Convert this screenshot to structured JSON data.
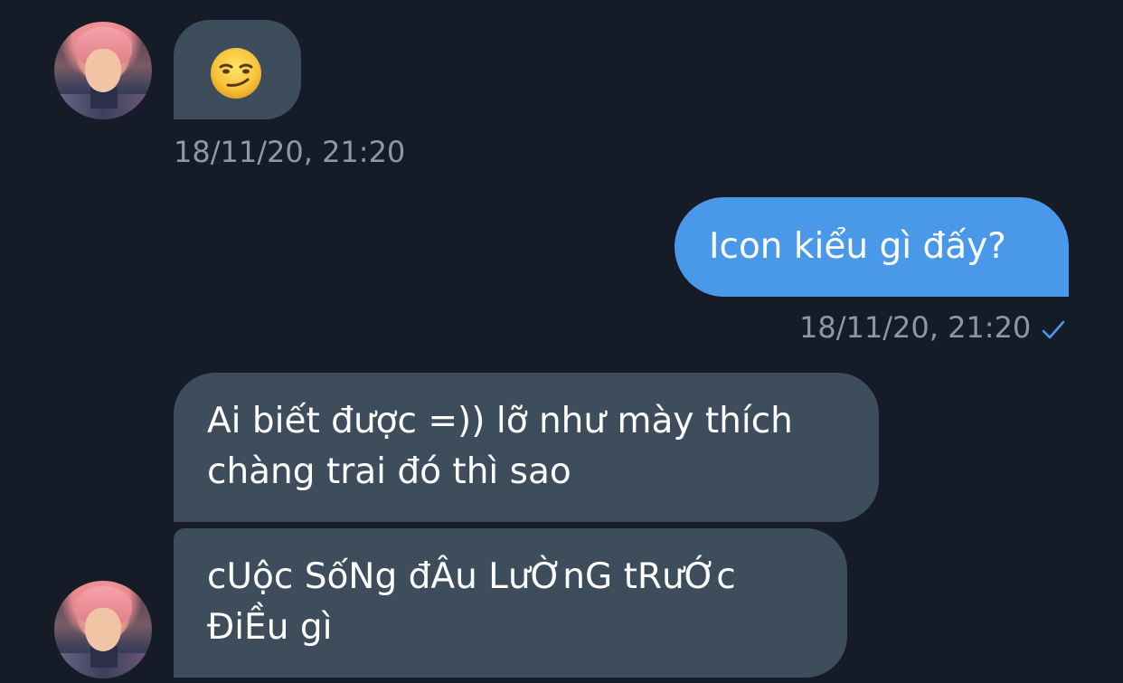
{
  "messages": [
    {
      "sender": "contact",
      "text": "",
      "emoji": "smirking-face",
      "timestamp": "18/11/20, 21:20"
    },
    {
      "sender": "me",
      "text": "Icon kiểu gì đấy?",
      "timestamp": "18/11/20, 21:20",
      "status": "sent"
    },
    {
      "sender": "contact",
      "text_lines": [
        "Ai biết được =)) lỡ như mày thích",
        "chàng trai đó thì sao"
      ]
    },
    {
      "sender": "contact",
      "text_lines": [
        "cUộc SốNg đÂu LưỜnG tRưỚc",
        "ĐiỀu gì"
      ]
    }
  ],
  "colors": {
    "background": "#151c27",
    "incoming_bubble": "#3d4d5c",
    "outgoing_bubble": "#4a99e9",
    "timestamp": "#8b98a5",
    "check": "#4a99e9"
  },
  "icons": {
    "avatar": "contact-avatar",
    "read_receipt": "checkmark-icon"
  }
}
